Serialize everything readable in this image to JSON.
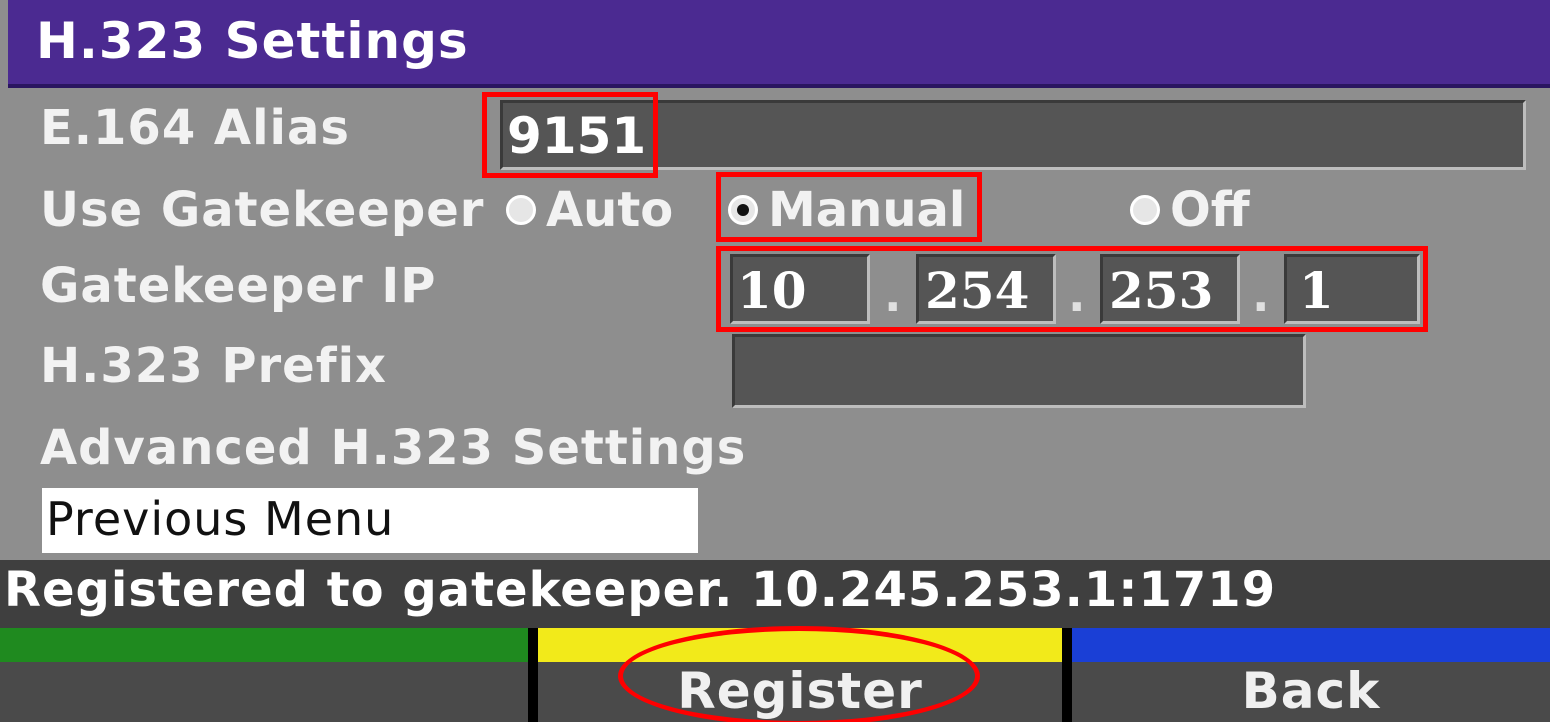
{
  "window": {
    "title": "H.323 Settings"
  },
  "form": {
    "alias_label": "E.164 Alias",
    "alias_value": "9151",
    "gatekeeper_label": "Use Gatekeeper",
    "gatekeeper_options": [
      "Auto",
      "Manual",
      "Off"
    ],
    "gatekeeper_selected": "Manual",
    "gatekeeper_ip_label": "Gatekeeper IP",
    "gatekeeper_ip": [
      "10",
      "254",
      "253",
      "1"
    ],
    "ip_separator": ".",
    "prefix_label": "H.323 Prefix",
    "prefix_value": "",
    "advanced_label": "Advanced H.323 Settings",
    "previous_menu_label": "Previous Menu"
  },
  "status": {
    "text": "Registered to gatekeeper. 10.245.253.1:1719"
  },
  "soft_keys": [
    {
      "label": "",
      "color": "#1f8a1f"
    },
    {
      "label": "Register",
      "color": "#f2ea1a"
    },
    {
      "label": "Back",
      "color": "#1a3fd6"
    }
  ],
  "colors": {
    "title_bar": "#4b2a91",
    "background": "#8e8e8e",
    "highlight_annotation": "#ff0000"
  }
}
